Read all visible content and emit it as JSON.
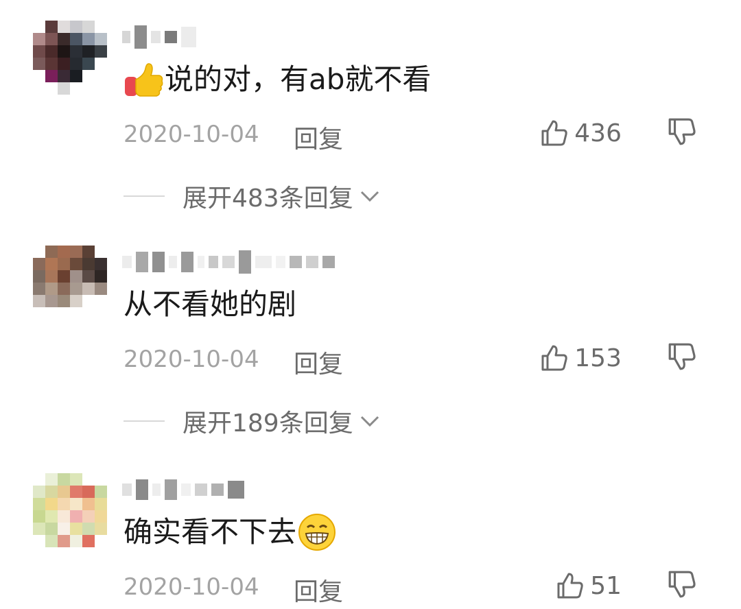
{
  "comments": [
    {
      "text": "说的对，有ab就不看",
      "emoji": "thumbs-up",
      "date": "2020-10-04",
      "reply_label": "回复",
      "likes": "436",
      "expand_label": "展开483条回复"
    },
    {
      "text": "从不看她的剧",
      "date": "2020-10-04",
      "reply_label": "回复",
      "likes": "153",
      "expand_label": "展开189条回复"
    },
    {
      "text": "确实看不下去",
      "emoji": "grin",
      "date": "2020-10-04",
      "reply_label": "回复",
      "likes": "51"
    }
  ],
  "colors": {
    "text_primary": "#1a1a1a",
    "text_secondary": "#6b6b6b",
    "text_muted": "#a3a3a3"
  }
}
